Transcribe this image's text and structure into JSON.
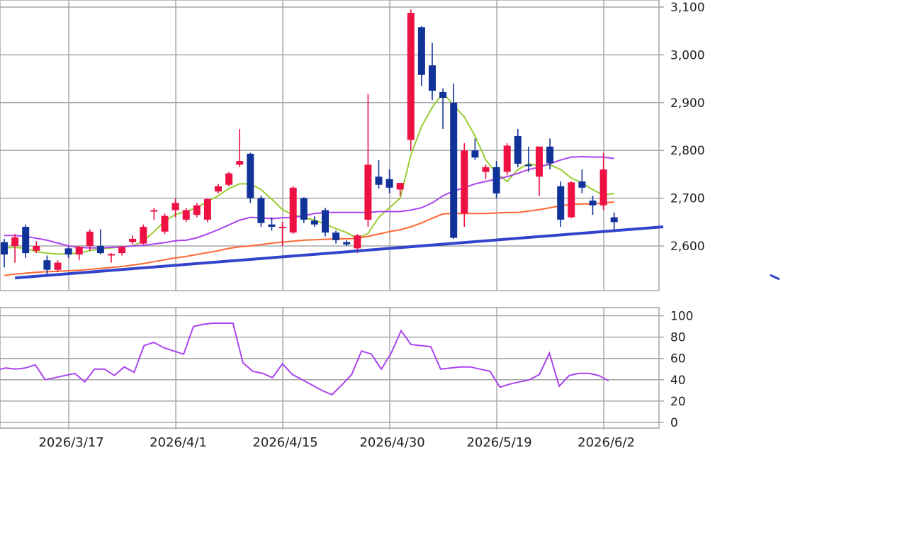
{
  "chart_data": [
    {
      "type": "candlestick",
      "title": "",
      "y_axis_position": "right",
      "ylim": [
        2510,
        3110
      ],
      "yticks": [
        2600,
        2700,
        2800,
        2900,
        3000,
        3100
      ],
      "ytick_labels": [
        "2,600",
        "2,700",
        "2,800",
        "2,900",
        "3,000",
        "3,100"
      ],
      "grid": true,
      "colors": {
        "up": "#ee1144",
        "down": "#113399",
        "ma_short": "#99cc33",
        "ma_mid": "#aa44ee",
        "ma_long": "#ff6633",
        "trendline": "#3344cc"
      },
      "candles": [
        {
          "date": "2026/3/9",
          "open": 2608,
          "high": 2615,
          "low": 2555,
          "close": 2582
        },
        {
          "date": "2026/3/10",
          "open": 2600,
          "high": 2625,
          "low": 2565,
          "close": 2618
        },
        {
          "date": "2026/3/11",
          "open": 2640,
          "high": 2645,
          "low": 2575,
          "close": 2585
        },
        {
          "date": "2026/3/12",
          "open": 2590,
          "high": 2610,
          "low": 2585,
          "close": 2600
        },
        {
          "date": "2026/3/13",
          "open": 2570,
          "high": 2580,
          "low": 2540,
          "close": 2550
        },
        {
          "date": "2026/3/16",
          "open": 2550,
          "high": 2570,
          "low": 2545,
          "close": 2565
        },
        {
          "date": "2026/3/17",
          "open": 2595,
          "high": 2598,
          "low": 2575,
          "close": 2582
        },
        {
          "date": "2026/3/18",
          "open": 2582,
          "high": 2600,
          "low": 2570,
          "close": 2598
        },
        {
          "date": "2026/3/19",
          "open": 2600,
          "high": 2635,
          "low": 2590,
          "close": 2630
        },
        {
          "date": "2026/3/23",
          "open": 2600,
          "high": 2635,
          "low": 2582,
          "close": 2585
        },
        {
          "date": "2026/3/24",
          "open": 2580,
          "high": 2585,
          "low": 2565,
          "close": 2583
        },
        {
          "date": "2026/3/25",
          "open": 2585,
          "high": 2600,
          "low": 2580,
          "close": 2598
        },
        {
          "date": "2026/3/26",
          "open": 2608,
          "high": 2622,
          "low": 2603,
          "close": 2615
        },
        {
          "date": "2026/3/27",
          "open": 2605,
          "high": 2645,
          "low": 2603,
          "close": 2640
        },
        {
          "date": "2026/3/30",
          "open": 2672,
          "high": 2680,
          "low": 2655,
          "close": 2675
        },
        {
          "date": "2026/3/31",
          "open": 2630,
          "high": 2668,
          "low": 2625,
          "close": 2663
        },
        {
          "date": "2026/4/1",
          "open": 2675,
          "high": 2700,
          "low": 2660,
          "close": 2690
        },
        {
          "date": "2026/4/2",
          "open": 2655,
          "high": 2680,
          "low": 2650,
          "close": 2675
        },
        {
          "date": "2026/4/3",
          "open": 2665,
          "high": 2690,
          "low": 2660,
          "close": 2685
        },
        {
          "date": "2026/4/6",
          "open": 2655,
          "high": 2700,
          "low": 2650,
          "close": 2698
        },
        {
          "date": "2026/4/7",
          "open": 2714,
          "high": 2730,
          "low": 2710,
          "close": 2725
        },
        {
          "date": "2026/4/8",
          "open": 2728,
          "high": 2755,
          "low": 2725,
          "close": 2752
        },
        {
          "date": "2026/4/9",
          "open": 2770,
          "high": 2845,
          "low": 2765,
          "close": 2778
        },
        {
          "date": "2026/4/10",
          "open": 2793,
          "high": 2795,
          "low": 2690,
          "close": 2700
        },
        {
          "date": "2026/4/13",
          "open": 2700,
          "high": 2705,
          "low": 2640,
          "close": 2648
        },
        {
          "date": "2026/4/14",
          "open": 2645,
          "high": 2660,
          "low": 2632,
          "close": 2640
        },
        {
          "date": "2026/4/15",
          "open": 2640,
          "high": 2650,
          "low": 2600,
          "close": 2640
        },
        {
          "date": "2026/4/16",
          "open": 2628,
          "high": 2725,
          "low": 2625,
          "close": 2722
        },
        {
          "date": "2026/4/17",
          "open": 2700,
          "high": 2702,
          "low": 2648,
          "close": 2655
        },
        {
          "date": "2026/4/20",
          "open": 2653,
          "high": 2662,
          "low": 2640,
          "close": 2645
        },
        {
          "date": "2026/4/21",
          "open": 2675,
          "high": 2680,
          "low": 2620,
          "close": 2628
        },
        {
          "date": "2026/4/22",
          "open": 2628,
          "high": 2632,
          "low": 2605,
          "close": 2612
        },
        {
          "date": "2026/4/23",
          "open": 2608,
          "high": 2612,
          "low": 2600,
          "close": 2603
        },
        {
          "date": "2026/4/24",
          "open": 2595,
          "high": 2625,
          "low": 2585,
          "close": 2622
        },
        {
          "date": "2026/4/27",
          "open": 2655,
          "high": 2918,
          "low": 2640,
          "close": 2770
        },
        {
          "date": "2026/4/28",
          "open": 2745,
          "high": 2780,
          "low": 2720,
          "close": 2728
        },
        {
          "date": "2026/4/29",
          "open": 2740,
          "high": 2760,
          "low": 2710,
          "close": 2722
        },
        {
          "date": "2026/4/30",
          "open": 2718,
          "high": 2730,
          "low": 2705,
          "close": 2732
        },
        {
          "date": "2026/5/1",
          "open": 2822,
          "high": 3095,
          "low": 2800,
          "close": 3088
        },
        {
          "date": "2026/5/7",
          "open": 3058,
          "high": 3060,
          "low": 2935,
          "close": 2958
        },
        {
          "date": "2026/5/8",
          "open": 2978,
          "high": 3025,
          "low": 2905,
          "close": 2925
        },
        {
          "date": "2026/5/11",
          "open": 2922,
          "high": 2930,
          "low": 2845,
          "close": 2910
        },
        {
          "date": "2026/5/12",
          "open": 2900,
          "high": 2940,
          "low": 2615,
          "close": 2617
        },
        {
          "date": "2026/5/13",
          "open": 2668,
          "high": 2815,
          "low": 2640,
          "close": 2800
        },
        {
          "date": "2026/5/14",
          "open": 2800,
          "high": 2825,
          "low": 2780,
          "close": 2785
        },
        {
          "date": "2026/5/15",
          "open": 2755,
          "high": 2770,
          "low": 2740,
          "close": 2765
        },
        {
          "date": "2026/5/18",
          "open": 2765,
          "high": 2778,
          "low": 2700,
          "close": 2710
        },
        {
          "date": "2026/5/19",
          "open": 2755,
          "high": 2815,
          "low": 2748,
          "close": 2810
        },
        {
          "date": "2026/5/20",
          "open": 2830,
          "high": 2845,
          "low": 2765,
          "close": 2772
        },
        {
          "date": "2026/5/21",
          "open": 2770,
          "high": 2808,
          "low": 2755,
          "close": 2768
        },
        {
          "date": "2026/5/22",
          "open": 2745,
          "high": 2808,
          "low": 2705,
          "close": 2808
        },
        {
          "date": "2026/5/25",
          "open": 2808,
          "high": 2825,
          "low": 2760,
          "close": 2773
        },
        {
          "date": "2026/5/26",
          "open": 2725,
          "high": 2735,
          "low": 2640,
          "close": 2655
        },
        {
          "date": "2026/5/27",
          "open": 2660,
          "high": 2735,
          "low": 2658,
          "close": 2733
        },
        {
          "date": "2026/5/28",
          "open": 2735,
          "high": 2760,
          "low": 2710,
          "close": 2722
        },
        {
          "date": "2026/5/29",
          "open": 2695,
          "high": 2705,
          "low": 2665,
          "close": 2685
        },
        {
          "date": "2026/6/1",
          "open": 2685,
          "high": 2795,
          "low": 2675,
          "close": 2760
        },
        {
          "date": "2026/6/2",
          "open": 2660,
          "high": 2670,
          "low": 2630,
          "close": 2650
        }
      ],
      "moving_averages": [
        {
          "color": "#99cc33",
          "values": [
            2596,
            2597,
            2595,
            2588,
            2585,
            2583,
            2584,
            2585,
            2590,
            2594,
            2596,
            2598,
            2600,
            2610,
            2630,
            2652,
            2666,
            2672,
            2680,
            2693,
            2705,
            2720,
            2730,
            2730,
            2718,
            2698,
            2676,
            2665,
            2660,
            2654,
            2646,
            2636,
            2628,
            2616,
            2626,
            2660,
            2680,
            2700,
            2790,
            2850,
            2890,
            2920,
            2895,
            2870,
            2830,
            2780,
            2752,
            2735,
            2760,
            2772,
            2768,
            2770,
            2760,
            2742,
            2732,
            2718,
            2706,
            2710
          ]
        },
        {
          "color": "#aa44ee",
          "values": [
            2622,
            2622,
            2620,
            2616,
            2612,
            2606,
            2600,
            2597,
            2596,
            2596,
            2597,
            2598,
            2600,
            2601,
            2604,
            2607,
            2611,
            2612,
            2617,
            2625,
            2634,
            2644,
            2654,
            2660,
            2659,
            2657,
            2659,
            2660,
            2663,
            2668,
            2670,
            2670,
            2670,
            2670,
            2670,
            2672,
            2672,
            2672,
            2675,
            2680,
            2690,
            2705,
            2715,
            2722,
            2730,
            2735,
            2740,
            2745,
            2752,
            2760,
            2765,
            2772,
            2780,
            2786,
            2787,
            2786,
            2786,
            2783
          ]
        },
        {
          "color": "#ff6633",
          "values": [
            2538,
            2541,
            2543,
            2545,
            2546,
            2547,
            2548,
            2549,
            2551,
            2553,
            2555,
            2557,
            2560,
            2563,
            2567,
            2571,
            2575,
            2578,
            2582,
            2586,
            2590,
            2595,
            2598,
            2600,
            2603,
            2606,
            2608,
            2610,
            2612,
            2613,
            2614,
            2615,
            2615,
            2616,
            2620,
            2625,
            2630,
            2634,
            2640,
            2648,
            2658,
            2667,
            2668,
            2668,
            2668,
            2668,
            2669,
            2670,
            2670,
            2673,
            2676,
            2680,
            2684,
            2687,
            2688,
            2688,
            2690,
            2692
          ]
        }
      ],
      "trendline": [
        {
          "date": "2026/3/10",
          "value": 2533
        },
        {
          "date": "2026/6/5",
          "value": 2640
        }
      ]
    },
    {
      "type": "line",
      "ylim": [
        0,
        100
      ],
      "yticks": [
        0,
        20,
        40,
        60,
        80,
        100
      ],
      "grid": true,
      "color": "#aa44ee",
      "values": [
        49,
        51,
        50,
        51,
        54,
        40,
        42,
        44,
        46,
        38,
        50,
        50,
        44,
        52,
        47,
        72,
        75,
        70,
        67,
        64,
        90,
        92,
        93,
        93,
        93,
        56,
        48,
        46,
        42,
        55,
        45,
        40,
        35,
        30,
        26,
        35,
        45,
        67,
        64,
        50,
        65,
        86,
        73,
        72,
        71,
        50,
        51,
        52,
        52,
        50,
        48,
        33,
        36,
        38,
        40,
        45,
        65,
        34,
        44,
        46,
        46,
        44,
        39
      ]
    }
  ],
  "x_axis": {
    "ticks": [
      {
        "index": 6,
        "label": "2026/3/17"
      },
      {
        "index": 16,
        "label": "2026/4/1"
      },
      {
        "index": 26,
        "label": "2026/4/15"
      },
      {
        "index": 36,
        "label": "2026/4/30"
      },
      {
        "index": 46,
        "label": "2026/5/19"
      },
      {
        "index": 56,
        "label": "2026/6/2"
      }
    ]
  }
}
